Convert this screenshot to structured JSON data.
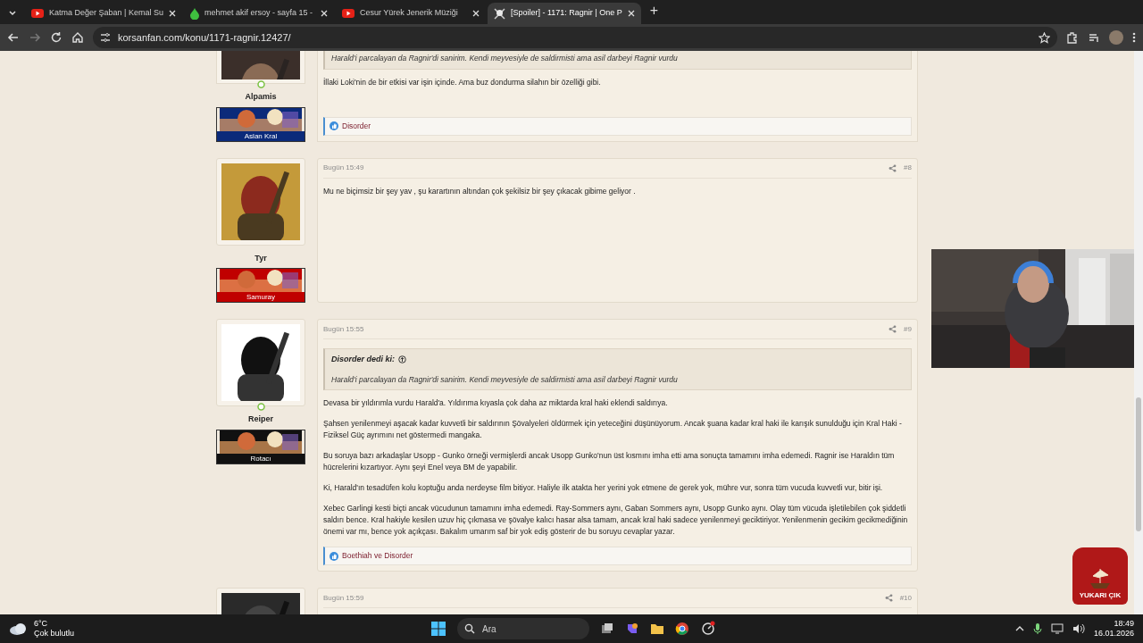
{
  "browser": {
    "tabs": [
      {
        "title": "Katma Değer Şaban | Kemal Su",
        "kind": "video",
        "selected": false
      },
      {
        "title": "mehmet akif ersoy - sayfa 15 -",
        "kind": "drop",
        "selected": false
      },
      {
        "title": "Cesur Yürek Jenerik Müziği",
        "kind": "video",
        "selected": false
      },
      {
        "title": "[Spoiler] - 1171: Ragnir | One P",
        "kind": "skull",
        "selected": true
      }
    ],
    "new_tab": "+",
    "url": "korsanfan.com/konu/1171-ragnir.12427/"
  },
  "posts": [
    {
      "author": "Alpamis",
      "online": true,
      "rank": "Aslan Kral",
      "color": "#0b2a7a",
      "quote": {
        "text": "Harald'i parcalayan da Ragnir'di sanirim. Kendi meyvesiyle de saldirmisti ama asil darbeyi Ragnir vurdu"
      },
      "paragraphs": [
        "İllaki Loki'nin de bir etkisi var işin içinde. Ama buz dondurma silahın bir özelliği gibi."
      ],
      "reactions": "Disorder"
    },
    {
      "author": "Tyr",
      "online": false,
      "rank": "Samuray",
      "color": "#c00000",
      "time": "Bugün 15:49",
      "number": "#8",
      "paragraphs": [
        "Mu ne biçimsiz bir şey yav , şu karartının altından çok şekilsiz bir şey çıkacak gibime geliyor ."
      ]
    },
    {
      "author": "Reiper",
      "online": true,
      "rank": "Rotacı",
      "color": "#111111",
      "time": "Bugün 15:55",
      "number": "#9",
      "quote": {
        "author": "Disorder dedi ki:",
        "text": "Harald'i parcalayan da Ragnir'di sanirim. Kendi meyvesiyle de saldirmisti ama asil darbeyi Ragnir vurdu"
      },
      "paragraphs": [
        "Devasa bir yıldırımla vurdu Harald'a. Yıldırıma kıyasla çok daha az miktarda kral haki eklendi saldırıya.",
        "Şahsen yenilenmeyi aşacak kadar kuvvetli bir saldırının Şövalyeleri öldürmek için yeteceğini düşünüyorum. Ancak şuana kadar kral haki ile karışık sunulduğu için Kral Haki - Fiziksel Güç ayrımını net göstermedi mangaka.",
        "Bu soruya bazı arkadaşlar Usopp - Gunko örneği vermişlerdi ancak Usopp Gunko'nun üst kısmını imha etti ama sonuçta tamamını imha edemedi. Ragnir ise Haraldın tüm hücrelerini kızartıyor. Aynı şeyi Enel veya BM de yapabilir.",
        "Ki, Harald'ın tesadüfen kolu koptuğu anda nerdeyse film bitiyor. Haliyle ilk atakta her yerini yok etmene de gerek yok, mühre vur, sonra tüm vucuda kuvvetli vur, bitir işi.",
        "Xebec Garlingi kesti biçti ancak vücudunun tamamını imha edemedi. Ray-Sommers aynı, Gaban Sommers aynı, Usopp Gunko aynı. Olay tüm vücuda işletilebilen çok şiddetli saldırı bence. Kral hakiyle kesilen uzuv hiç çıkmasa ve şövalye kalıcı hasar alsa tamam, ancak kral haki sadece yenilenmeyi geciktiriyor. Yenilenmenin gecikim gecikmediğinin önemi var mı, bence yok açıkçası. Bakalım umarım saf bir yok ediş gösterir de bu soruyu cevaplar yazar."
      ],
      "reactions": "Boethiah ve Disorder"
    },
    {
      "time": "Bugün 15:59",
      "number": "#10"
    }
  ],
  "back_to_top": "YUKARI ÇIK",
  "taskbar": {
    "temperature": "6°C",
    "weather": "Çok bulutlu",
    "search_placeholder": "Ara",
    "time": "18:49",
    "date": "16.01.2026"
  }
}
